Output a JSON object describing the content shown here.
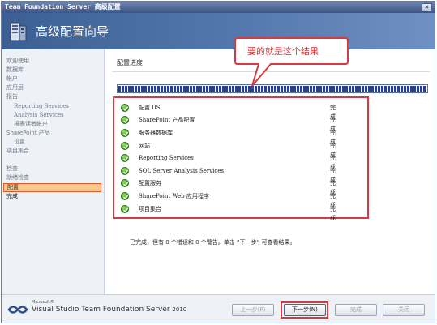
{
  "window": {
    "title": "Team Foundation Server 高级配置",
    "close_glyph": "×"
  },
  "header": {
    "title": "高级配置向导"
  },
  "leftnav": {
    "items": [
      {
        "label": "欢迎使用",
        "indent": 0,
        "state": "normal"
      },
      {
        "label": "数据库",
        "indent": 0,
        "state": "normal"
      },
      {
        "label": "帐户",
        "indent": 0,
        "state": "normal"
      },
      {
        "label": "应用层",
        "indent": 0,
        "state": "normal"
      },
      {
        "label": "报告",
        "indent": 0,
        "state": "normal"
      },
      {
        "label": "Reporting Services",
        "indent": 1,
        "state": "normal"
      },
      {
        "label": "Analysis Services",
        "indent": 1,
        "state": "normal"
      },
      {
        "label": "报表读者帐户",
        "indent": 1,
        "state": "normal"
      },
      {
        "label": "SharePoint 产品",
        "indent": 0,
        "state": "normal"
      },
      {
        "label": "设置",
        "indent": 1,
        "state": "normal"
      },
      {
        "label": "项目集合",
        "indent": 0,
        "state": "normal"
      },
      {
        "label": "检查",
        "indent": 0,
        "state": "normal"
      },
      {
        "label": "就绪检查",
        "indent": 0,
        "state": "normal"
      },
      {
        "label": "配置",
        "indent": 0,
        "state": "active"
      },
      {
        "label": "完成",
        "indent": 0,
        "state": "bold"
      }
    ]
  },
  "main": {
    "section_title": "配置进度",
    "progress_percent": 100,
    "tasks": [
      {
        "name": "配置 IIS",
        "status": "完成"
      },
      {
        "name": "SharePoint 产品配置",
        "status": "完成"
      },
      {
        "name": "服务器数据库",
        "status": "完成"
      },
      {
        "name": "网站",
        "status": "完成"
      },
      {
        "name": "Reporting Services",
        "status": "完成"
      },
      {
        "name": "SQL Server Analysis Services",
        "status": "完成"
      },
      {
        "name": "配置服务",
        "status": "完成"
      },
      {
        "name": "SharePoint Web 应用程序",
        "status": "完成"
      },
      {
        "name": "项目集合",
        "status": "完成"
      }
    ],
    "summary": "已完成，但有 0 个错误和 0 个警告。单击 “下一步” 可查看结果。"
  },
  "callout": {
    "text": "要的就是这个结果"
  },
  "footer": {
    "ms_label": "Microsoft®",
    "product_main": "Visual Studio Team Foundation Server",
    "product_year": "2010",
    "buttons": {
      "back": "上一步(P)",
      "next": "下一步(N)",
      "finish": "完成",
      "close": "关闭"
    }
  },
  "colors": {
    "header_start": "#3c5f93",
    "header_end": "#6f90c2",
    "highlight_red": "#d43a3f",
    "check_green": "#3f9a22",
    "progress_blue": "#2a3e8a",
    "active_nav_fill": "#f7c98e"
  }
}
